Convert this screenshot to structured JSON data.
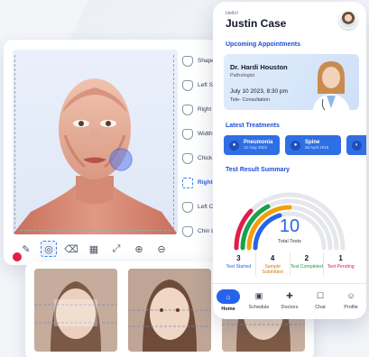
{
  "colors": {
    "accent": "#2563eb",
    "badge": "#2f6fe4",
    "pending": "#e11d48",
    "started": "#2563eb",
    "submitted": "#d97706",
    "completed": "#16a34a"
  },
  "analysis": {
    "tools": [
      "pen-icon",
      "target-icon",
      "eraser-icon",
      "grid-icon",
      "expand-icon",
      "zoom-in-icon",
      "zoom-out-icon"
    ],
    "measurements": [
      {
        "label": "Shape"
      },
      {
        "label": "Left Sh"
      },
      {
        "label": "Right S"
      },
      {
        "label": "Width"
      },
      {
        "label": "Chick t"
      },
      {
        "label": "Right C",
        "selected": true
      },
      {
        "label": "Left Ch"
      },
      {
        "label": "Chin Le"
      }
    ]
  },
  "phone": {
    "greeting": "Hello!",
    "user_name": "Justin Case",
    "upcoming_title": "Upcoming Appointments",
    "appointment": {
      "doctor": "Dr. Hardi Houston",
      "specialty": "Pathologist",
      "datetime": "July 10 2023, 8:30 pm",
      "type": "Tele- Consultation"
    },
    "treatments_title": "Latest Treatments",
    "treatments": [
      {
        "name": "Pneumonia",
        "date": "12 may 2022",
        "icon": "lungs-icon"
      },
      {
        "name": "Spine",
        "date": "26 April 2018",
        "icon": "spine-icon"
      }
    ],
    "summary_title": "Test Result Summary",
    "total": "10",
    "total_label": "Total Tests",
    "stats": [
      {
        "count": "3",
        "label": "Test Started"
      },
      {
        "count": "4",
        "label": "Sample Submitted"
      },
      {
        "count": "2",
        "label": "Test Completed"
      },
      {
        "count": "1",
        "label": "Test Pending"
      }
    ],
    "nav": [
      {
        "label": "Home",
        "icon": "home-icon",
        "active": true
      },
      {
        "label": "Schedule",
        "icon": "calendar-icon"
      },
      {
        "label": "Doctors",
        "icon": "medical-bag-icon"
      },
      {
        "label": "Chat",
        "icon": "chat-icon"
      },
      {
        "label": "Profile",
        "icon": "user-icon"
      }
    ]
  }
}
